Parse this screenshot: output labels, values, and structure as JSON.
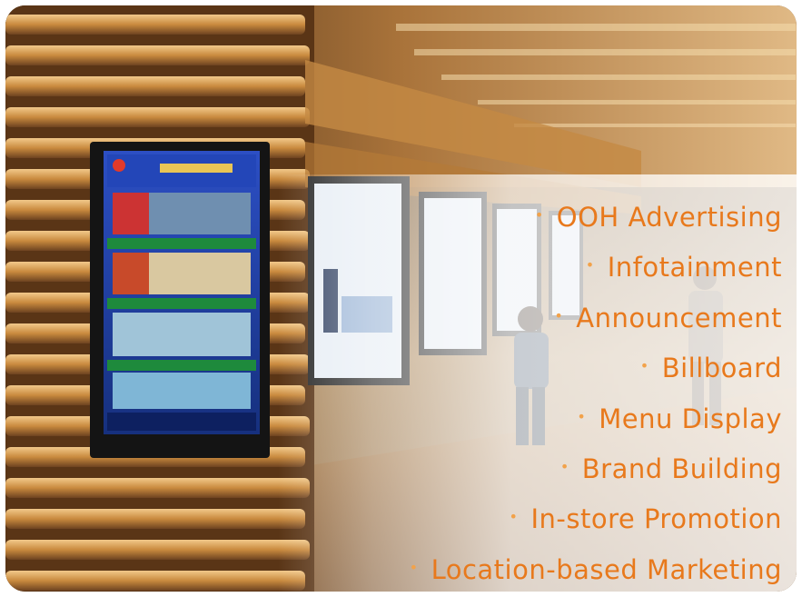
{
  "features": [
    "OOH Advertising",
    "Infotainment",
    "Announcement",
    "Billboard",
    "Menu Display",
    "Brand Building",
    "In-store Promotion",
    "Location-based Marketing"
  ],
  "bullet_char": "•",
  "colors": {
    "feature_text": "#e8791c",
    "bullet": "#f2a24a",
    "screen_blue": "#1e3ea8",
    "wall_wood": "#c98a3e"
  }
}
